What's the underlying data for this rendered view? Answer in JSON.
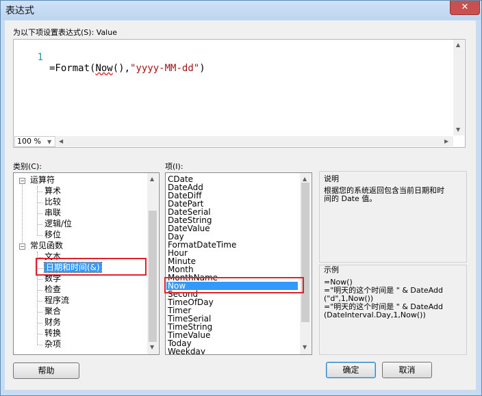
{
  "window": {
    "title": "表达式",
    "close_glyph": "✕"
  },
  "expression": {
    "label": "为以下项设置表达式(S): Value",
    "line_number": "1",
    "code_prefix": "=Format(",
    "code_now": "Now",
    "code_middle": "(),",
    "code_string": "\"yyyy-MM-dd\"",
    "code_suffix": ")",
    "zoom": "100 %"
  },
  "categories": {
    "label": "类别(C):",
    "items": [
      {
        "label": "运算符",
        "group": true,
        "expanded": true
      },
      {
        "label": "算术"
      },
      {
        "label": "比较"
      },
      {
        "label": "串联"
      },
      {
        "label": "逻辑/位"
      },
      {
        "label": "移位"
      },
      {
        "label": "常见函数",
        "group": true,
        "expanded": true
      },
      {
        "label": "文本"
      },
      {
        "label": "日期和时间(&)",
        "selected": true
      },
      {
        "label": "数学"
      },
      {
        "label": "检查"
      },
      {
        "label": "程序流"
      },
      {
        "label": "聚合"
      },
      {
        "label": "财务"
      },
      {
        "label": "转换"
      },
      {
        "label": "杂项"
      }
    ]
  },
  "items": {
    "label": "项(I):",
    "values": [
      "CDate",
      "DateAdd",
      "DateDiff",
      "DatePart",
      "DateSerial",
      "DateString",
      "DateValue",
      "Day",
      "FormatDateTime",
      "Hour",
      "Minute",
      "Month",
      "MonthName",
      "Now",
      "Second",
      "TimeOfDay",
      "Timer",
      "TimeSerial",
      "TimeString",
      "TimeValue",
      "Today",
      "Weekday"
    ],
    "selected": "Now"
  },
  "description": {
    "title": "说明",
    "text": "根据您的系统返回包含当前日期和时\n间的 Date 值。"
  },
  "example": {
    "title": "示例",
    "text": "=Now()\n=\"明天的这个时间是 \" & DateAdd\n(\"d\",1,Now())\n=\"明天的这个时间是 \" & DateAdd\n(DateInterval.Day,1,Now())"
  },
  "buttons": {
    "help": "帮助",
    "ok": "确定",
    "cancel": "取消"
  },
  "colors": {
    "selection": "#3399ff",
    "highlight_box": "#e0202a",
    "code_string": "#a31515",
    "line_number": "#2b91af"
  }
}
